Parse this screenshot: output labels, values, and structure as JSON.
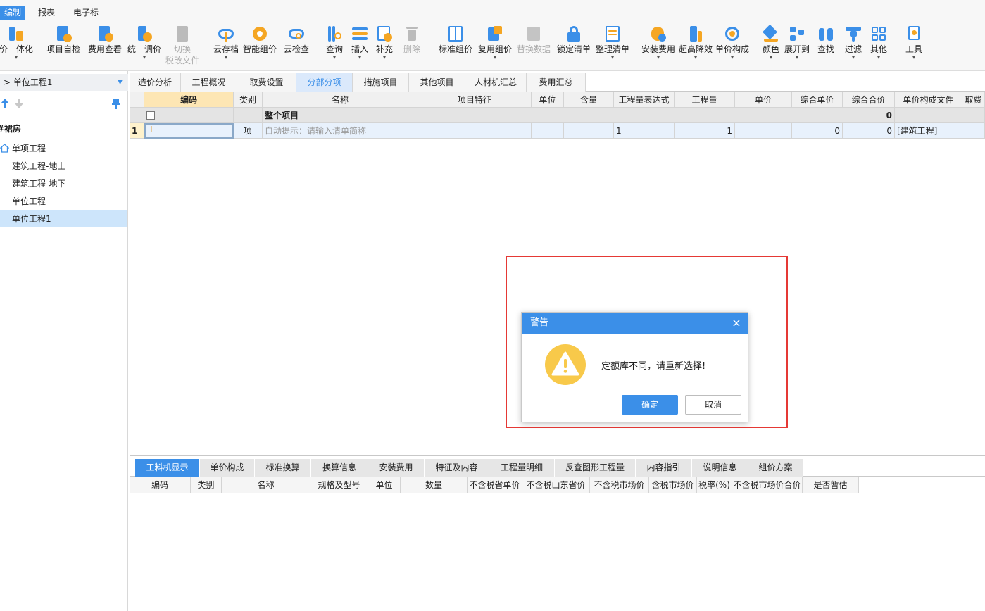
{
  "menu": {
    "items": [
      "编制",
      "报表",
      "电子标"
    ]
  },
  "toolbar": {
    "buttons": [
      {
        "label": "价一体化",
        "sub": ""
      },
      {
        "label": "项目自检",
        "sub": ""
      },
      {
        "label": "费用查看",
        "sub": ""
      },
      {
        "label": "统一调价",
        "sub": ""
      },
      {
        "label": "切换",
        "sub": "税改文件"
      },
      {
        "label": "云存档",
        "sub": ""
      },
      {
        "label": "智能组价",
        "sub": ""
      },
      {
        "label": "云检查",
        "sub": ""
      },
      {
        "label": "查询",
        "sub": ""
      },
      {
        "label": "插入",
        "sub": ""
      },
      {
        "label": "补充",
        "sub": ""
      },
      {
        "label": "删除",
        "sub": ""
      },
      {
        "label": "标准组价",
        "sub": ""
      },
      {
        "label": "复用组价",
        "sub": ""
      },
      {
        "label": "替换数据",
        "sub": ""
      },
      {
        "label": "锁定清单",
        "sub": ""
      },
      {
        "label": "整理清单",
        "sub": ""
      },
      {
        "label": "安装费用",
        "sub": ""
      },
      {
        "label": "超高降效",
        "sub": ""
      },
      {
        "label": "单价构成",
        "sub": ""
      },
      {
        "label": "颜色",
        "sub": ""
      },
      {
        "label": "展开到",
        "sub": ""
      },
      {
        "label": "查找",
        "sub": ""
      },
      {
        "label": "过滤",
        "sub": ""
      },
      {
        "label": "其他",
        "sub": ""
      },
      {
        "label": "工具",
        "sub": ""
      }
    ]
  },
  "left_panel": {
    "header": "> 单位工程1",
    "tree": [
      "#裙房",
      "单项工程",
      "建筑工程-地上",
      "建筑工程-地下",
      "单位工程",
      "单位工程1"
    ]
  },
  "tabs": [
    "造价分析",
    "工程概况",
    "取费设置",
    "分部分项",
    "措施项目",
    "其他项目",
    "人材机汇总",
    "费用汇总"
  ],
  "grid": {
    "columns": [
      "编码",
      "类别",
      "名称",
      "项目特征",
      "单位",
      "含量",
      "工程量表达式",
      "工程量",
      "单价",
      "综合单价",
      "综合合价",
      "单价构成文件",
      "取费"
    ],
    "total_row": {
      "toggle": "−",
      "name": "整个项目",
      "total": "0"
    },
    "data_row": {
      "index": "1",
      "category": "项",
      "name_hint": "自动提示：请输入清单简称",
      "expr": "1",
      "qty": "1",
      "comp_price": "0",
      "comp_total": "0",
      "price_file": "[建筑工程]"
    }
  },
  "bottom_tabs": [
    "工料机显示",
    "单价构成",
    "标准换算",
    "换算信息",
    "安装费用",
    "特征及内容",
    "工程量明细",
    "反查图形工程量",
    "内容指引",
    "说明信息",
    "组价方案"
  ],
  "bottom_grid": {
    "columns": [
      "编码",
      "类别",
      "名称",
      "规格及型号",
      "单位",
      "数量",
      "不含税省单价",
      "不含税山东省价",
      "不含税市场价",
      "含税市场价",
      "税率(%)",
      "不含税市场价合价",
      "是否暂估"
    ]
  },
  "dialog": {
    "title": "警告",
    "close": "×",
    "message": "定额库不同，请重新选择!",
    "ok": "确定",
    "cancel": "取消"
  },
  "colors": {
    "accent": "#3b8fe8",
    "highlight": "#e53935",
    "warning": "#f8c94a"
  }
}
